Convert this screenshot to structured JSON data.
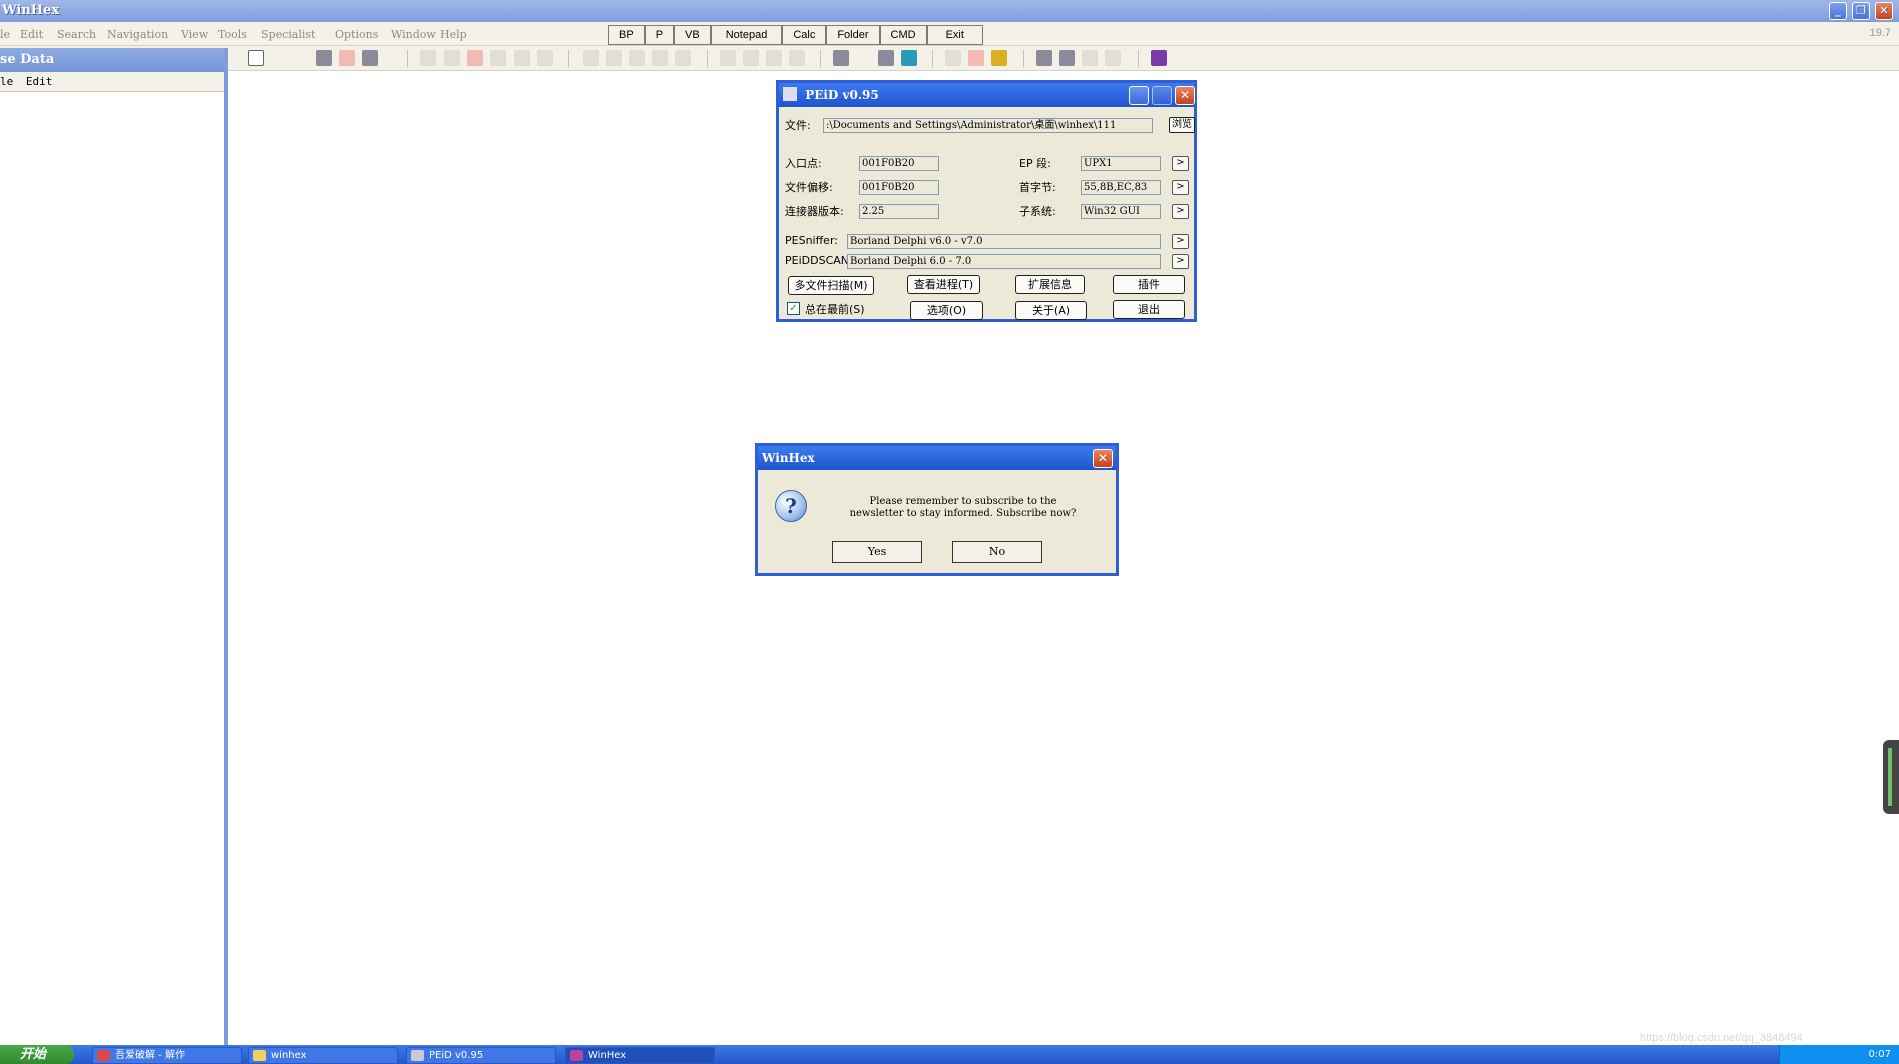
{
  "window": {
    "title": "WinHex",
    "version": "19.7"
  },
  "menu": [
    "le",
    "Edit",
    "Search",
    "Navigation",
    "View",
    "Tools",
    "Specialist",
    "Options",
    "Window",
    "Help"
  ],
  "quick_buttons": [
    "BP",
    "P",
    "VB",
    "Notepad",
    "Calc",
    "Folder",
    "CMD",
    "Exit"
  ],
  "left_panel": {
    "header": "se Data",
    "menu": [
      "le",
      "Edit"
    ]
  },
  "peid": {
    "title": "PEiD v0.95",
    "file_label": "文件:",
    "file_path": ":\\Documents and Settings\\Administrator\\桌面\\winhex\\111",
    "browse_label": "浏览",
    "entry_point_label": "入口点:",
    "entry_point": "001F0B20",
    "file_offset_label": "文件偏移:",
    "file_offset": "001F0B20",
    "linker_label": "连接器版本:",
    "linker": "2.25",
    "ep_section_label": "EP 段:",
    "ep_section": "UPX1",
    "first_bytes_label": "首字节:",
    "first_bytes": "55,8B,EC,83",
    "subsystem_label": "子系统:",
    "subsystem": "Win32 GUI",
    "pesniffer_label": "PESniffer:",
    "pesniffer": "Borland Delphi v6.0 - v7.0",
    "peiddscan_label": "PEiDDSCAN:",
    "peiddscan": "Borland Delphi 6.0 - 7.0",
    "arrow": ">",
    "buttons": {
      "multi_scan": "多文件扫描(M)",
      "view_process": "查看进程(T)",
      "ext_info": "扩展信息",
      "plugins": "插件",
      "options": "选项(O)",
      "about": "关于(A)",
      "exit": "退出"
    },
    "always_on_top_label": "总在最前(S)",
    "always_on_top_checked": true
  },
  "msgbox": {
    "title": "WinHex",
    "line1": "Please remember to subscribe to the",
    "line2": "newsletter to stay informed. Subscribe now?",
    "icon_glyph": "?",
    "yes": "Yes",
    "no": "No"
  },
  "taskbar": {
    "start": "开始",
    "tasks": [
      "吾爱破解 - 解作",
      "winhex",
      "PEiD v0.95",
      "WinHex"
    ],
    "clock": "0:07"
  },
  "watermark": "https://blog.csdn.net/qq_3848494"
}
